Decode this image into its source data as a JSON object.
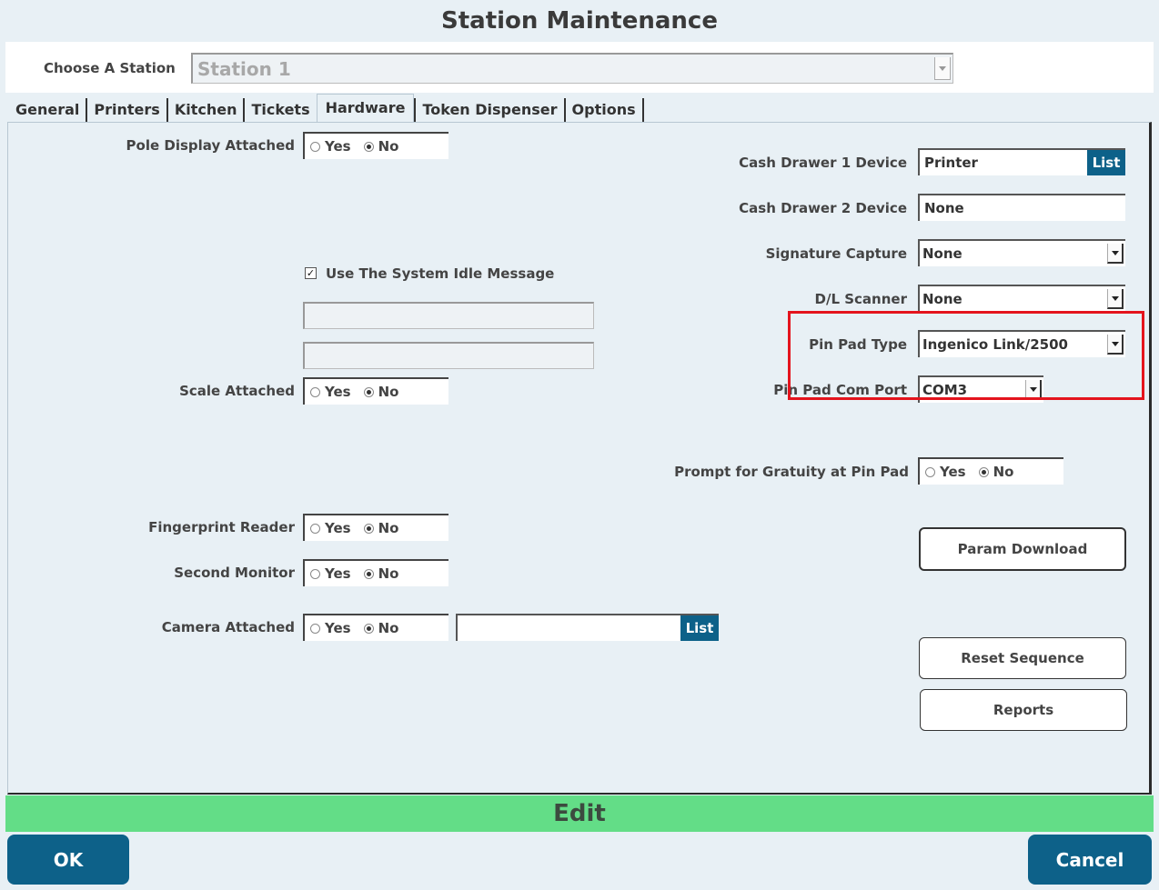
{
  "title": "Station Maintenance",
  "station": {
    "label": "Choose A Station",
    "value": "Station 1"
  },
  "tabs": [
    "General",
    "Printers",
    "Kitchen",
    "Tickets",
    "Hardware",
    "Token Dispenser",
    "Options"
  ],
  "active_tab": "Hardware",
  "radio": {
    "yes": "Yes",
    "no": "No"
  },
  "left": {
    "pole_display": {
      "label": "Pole Display Attached",
      "selected": "No"
    },
    "idle_message": {
      "label": "Use The System Idle Message",
      "checked": true
    },
    "scale": {
      "label": "Scale Attached",
      "selected": "No"
    },
    "fingerprint": {
      "label": "Fingerprint Reader",
      "selected": "No"
    },
    "second_monitor": {
      "label": "Second Monitor",
      "selected": "No"
    },
    "camera": {
      "label": "Camera Attached",
      "selected": "No",
      "list_label": "List",
      "value": ""
    }
  },
  "right": {
    "cash_drawer_1": {
      "label": "Cash Drawer 1 Device",
      "value": "Printer",
      "list_label": "List"
    },
    "cash_drawer_2": {
      "label": "Cash Drawer 2 Device",
      "value": "None"
    },
    "signature_capture": {
      "label": "Signature Capture",
      "value": "None"
    },
    "dl_scanner": {
      "label": "D/L Scanner",
      "value": "None"
    },
    "pin_pad_type": {
      "label": "Pin Pad Type",
      "value": "Ingenico Link/2500"
    },
    "pin_pad_com_port": {
      "label": "Pin Pad Com Port",
      "value": "COM3"
    },
    "gratuity": {
      "label": "Prompt for Gratuity at Pin Pad",
      "selected": "No"
    },
    "param_download": "Param Download",
    "reset_sequence": "Reset Sequence",
    "reports": "Reports"
  },
  "mode": "Edit",
  "ok": "OK",
  "cancel": "Cancel",
  "colors": {
    "accent": "#0d6189",
    "edit_bar": "#63dd87",
    "highlight": "#e4141d"
  }
}
